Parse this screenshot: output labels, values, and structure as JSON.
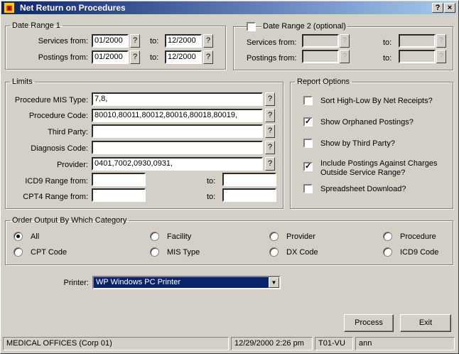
{
  "window": {
    "title": "Net Return on Procedures",
    "help_label": "?",
    "close_label": "×"
  },
  "date_range1": {
    "legend": "Date Range 1",
    "services_label": "Services from:",
    "services_from": "01/2000",
    "services_to": "12/2000",
    "postings_label": "Postings from:",
    "postings_from": "01/2000",
    "postings_to": "12/2000",
    "to_label": "to:"
  },
  "date_range2": {
    "legend": "Date Range 2 (optional)",
    "checked": false,
    "services_label": "Services from:",
    "postings_label": "Postings from:",
    "to_label": "to:"
  },
  "limits": {
    "legend": "Limits",
    "procedure_mis_type_label": "Procedure MIS Type:",
    "procedure_mis_type": "7,8,",
    "procedure_code_label": "Procedure Code:",
    "procedure_code": "80010,80011,80012,80016,80018,80019,",
    "third_party_label": "Third Party:",
    "third_party": "",
    "diagnosis_code_label": "Diagnosis Code:",
    "diagnosis_code": "",
    "provider_label": "Provider:",
    "provider": "0401,7002,0930,0931,",
    "icd9_label": "ICD9 Range from:",
    "cpt4_label": "CPT4 Range from:",
    "to_label": "to:"
  },
  "report_options": {
    "legend": "Report Options",
    "items": [
      {
        "label": "Sort High-Low By Net Receipts?",
        "checked": false
      },
      {
        "label": "Show Orphaned Postings?",
        "checked": true
      },
      {
        "label": "Show by Third Party?",
        "checked": false
      },
      {
        "label": "Include Postings Against Charges",
        "label2": "Outside Service Range?",
        "checked": true
      },
      {
        "label": "Spreadsheet  Download?",
        "checked": false
      }
    ]
  },
  "order_output": {
    "legend": "Order Output By Which Category",
    "options": [
      "All",
      "Facility",
      "Provider",
      "Procedure",
      "CPT Code",
      "MIS Type",
      "DX Code",
      "ICD9 Code"
    ],
    "selected": "All"
  },
  "printer": {
    "label": "Printer:",
    "value": "WP   Windows PC Printer"
  },
  "buttons": {
    "process": "Process",
    "exit": "Exit"
  },
  "status_bar": {
    "office": "MEDICAL OFFICES (Corp 01)",
    "datetime": "12/29/2000  2:26 pm",
    "terminal": "T01-VU",
    "user": "ann"
  },
  "glyphs": {
    "question": "?",
    "check": "✓",
    "dropdown": "▼"
  }
}
